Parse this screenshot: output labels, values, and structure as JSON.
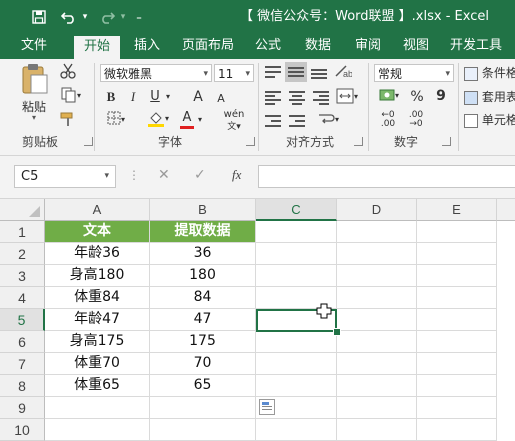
{
  "window": {
    "title": "【 微信公众号：Word联盟 】.xlsx - Excel"
  },
  "quick_access": {
    "icons": [
      "save-icon",
      "undo-icon",
      "redo-icon",
      "customize-icon"
    ]
  },
  "tabs": [
    {
      "label": "文件",
      "active": false
    },
    {
      "label": "开始",
      "active": true
    },
    {
      "label": "插入",
      "active": false
    },
    {
      "label": "页面布局",
      "active": false
    },
    {
      "label": "公式",
      "active": false
    },
    {
      "label": "数据",
      "active": false
    },
    {
      "label": "审阅",
      "active": false
    },
    {
      "label": "视图",
      "active": false
    },
    {
      "label": "开发工具",
      "active": false
    }
  ],
  "ribbon": {
    "clipboard": {
      "paste_label": "粘贴",
      "group_label": "剪贴板"
    },
    "font": {
      "font_name": "微软雅黑",
      "font_size": "11",
      "bold": "B",
      "italic": "I",
      "underline": "U",
      "grow": "A",
      "shrink": "A",
      "font_color": "A",
      "phonetic": "wén",
      "group_label": "字体"
    },
    "alignment": {
      "group_label": "对齐方式"
    },
    "number": {
      "format": "常规",
      "percent": "%",
      "comma": "9",
      "group_label": "数字"
    },
    "styles": {
      "conditional": "条件格",
      "table": "套用表",
      "cell": "单元格"
    },
    "accent_color": "#217346"
  },
  "formula_bar": {
    "name_box": "C5",
    "cancel": "✕",
    "enter": "✓",
    "fx": "fx",
    "formula": ""
  },
  "sheet": {
    "columns": [
      "A",
      "B",
      "C",
      "D",
      "E"
    ],
    "rows": [
      "1",
      "2",
      "3",
      "4",
      "5",
      "6",
      "7",
      "8",
      "9",
      "10"
    ],
    "header_fill": "#70ad47",
    "data": [
      [
        "文本",
        "提取数据"
      ],
      [
        "年龄36",
        "36"
      ],
      [
        "身高180",
        "180"
      ],
      [
        "体重84",
        "84"
      ],
      [
        "年龄47",
        "47"
      ],
      [
        "身高175",
        "175"
      ],
      [
        "体重70",
        "70"
      ],
      [
        "体重65",
        "65"
      ]
    ],
    "active_cell": "C5"
  }
}
